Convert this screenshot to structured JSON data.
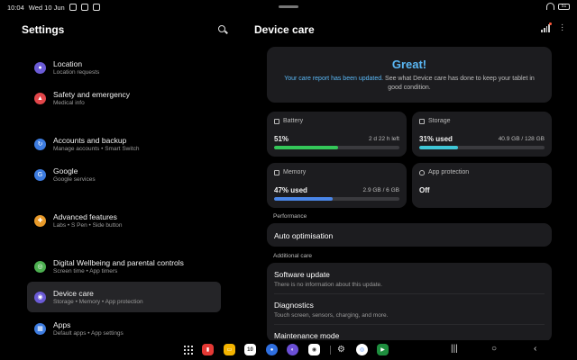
{
  "status": {
    "time": "10:04",
    "date": "Wed 10 Jun",
    "battery": "51"
  },
  "settings": {
    "title": "Settings",
    "items": [
      {
        "title": "Location",
        "sub": "Location requests",
        "color": "#6b5bd6"
      },
      {
        "title": "Safety and emergency",
        "sub": "Medical info",
        "color": "#e2464a"
      },
      {
        "title": "Accounts and backup",
        "sub": "Manage accounts • Smart Switch",
        "color": "#3d7ce0"
      },
      {
        "title": "Google",
        "sub": "Google services",
        "color": "#3d7ce0"
      },
      {
        "title": "Advanced features",
        "sub": "Labs • S Pen • Side button",
        "color": "#e89a2a"
      },
      {
        "title": "Digital Wellbeing and parental controls",
        "sub": "Screen time • App timers",
        "color": "#4caf50"
      },
      {
        "title": "Device care",
        "sub": "Storage • Memory • App protection",
        "color": "#6b5bd6"
      },
      {
        "title": "Apps",
        "sub": "Default apps • App settings",
        "color": "#3d7ce0"
      }
    ]
  },
  "device_care": {
    "title": "Device care",
    "status_title": "Great!",
    "status_link": "Your care report has been updated.",
    "status_msg": " See what Device care has done to keep your tablet in good condition.",
    "battery": {
      "label": "Battery",
      "value": "51%",
      "detail": "2 d 22 h left",
      "level": 0.51,
      "color": "#34c759"
    },
    "storage": {
      "label": "Storage",
      "value": "31% used",
      "detail": "40.9 GB / 128 GB",
      "level": 0.31,
      "color": "#3ec6d6"
    },
    "memory": {
      "label": "Memory",
      "value": "47% used",
      "detail": "2.9 GB / 6 GB",
      "level": 0.47,
      "color": "#4a86e8"
    },
    "protection": {
      "label": "App protection",
      "value": "Off"
    },
    "performance_label": "Performance",
    "auto_opt": "Auto optimisation",
    "additional_label": "Additional care",
    "software_update": {
      "title": "Software update",
      "sub": "There is no information about this update."
    },
    "diagnostics": {
      "title": "Diagnostics",
      "sub": "Touch screen, sensors, charging, and more."
    },
    "maintenance": {
      "title": "Maintenance mode"
    }
  },
  "dock": {
    "calendar_day": "10"
  }
}
